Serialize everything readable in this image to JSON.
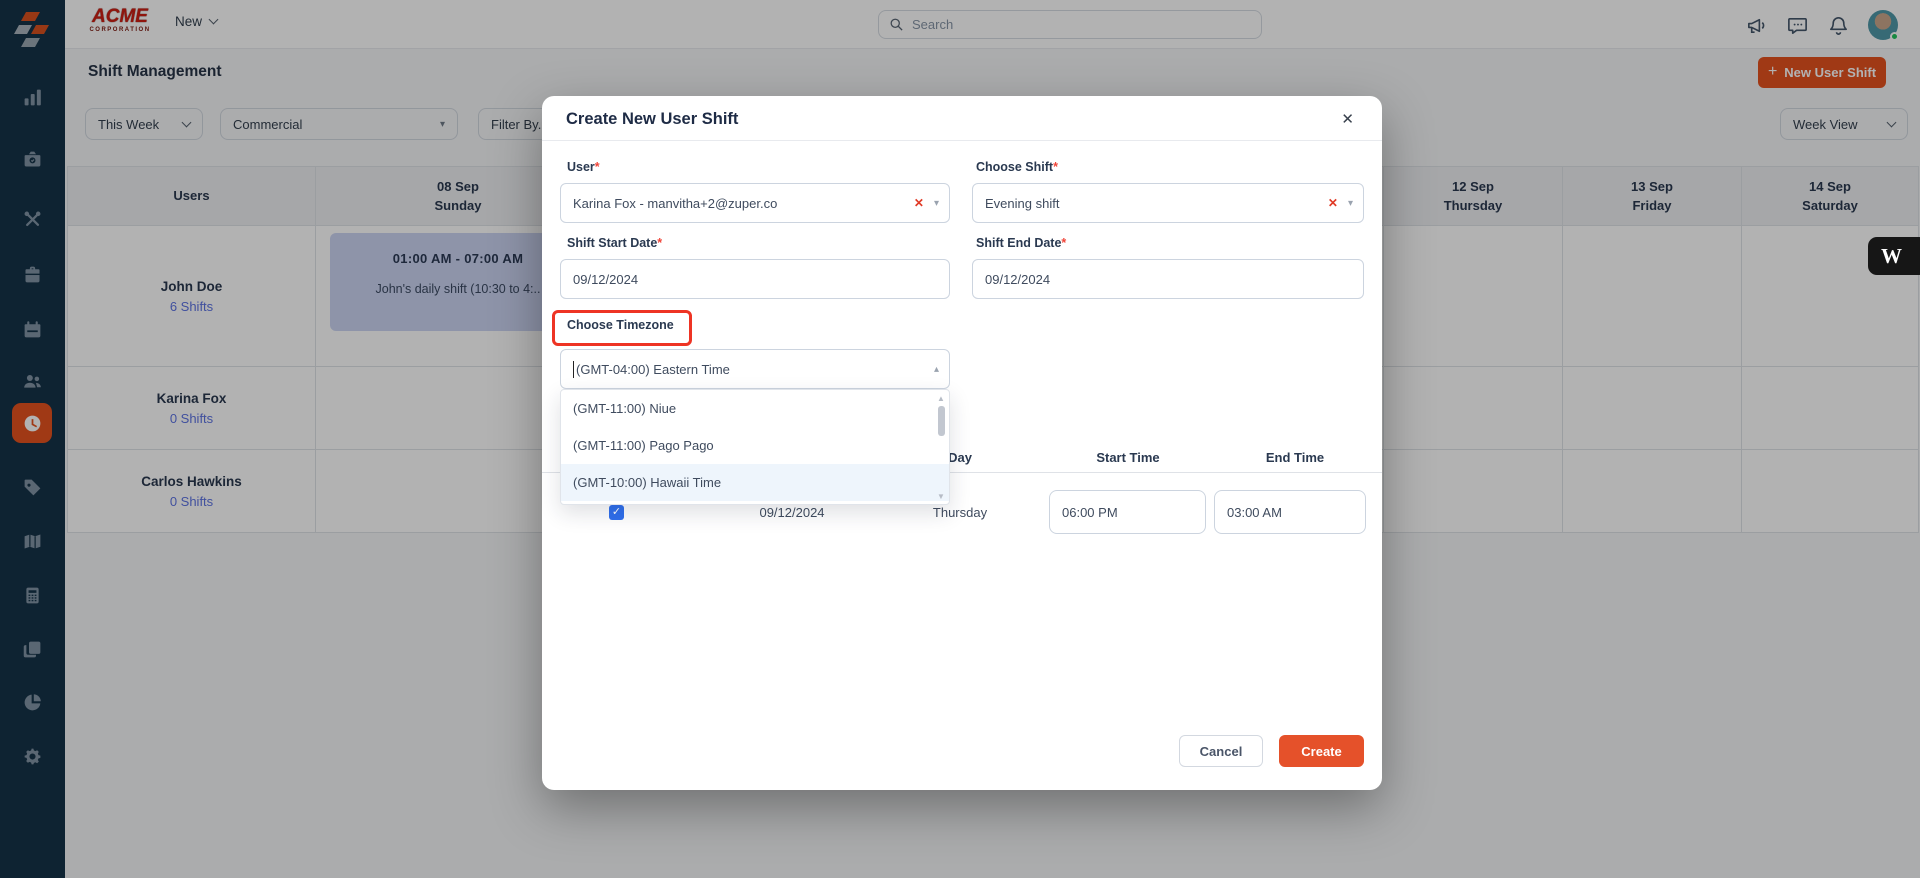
{
  "topbar": {
    "brand": "ACME",
    "brand_sub": "CORPORATION",
    "new_menu": "New",
    "search_placeholder": "Search"
  },
  "page": {
    "title": "Shift Management",
    "new_user_shift_button": "New User Shift"
  },
  "filters": {
    "range": "This Week",
    "category": "Commercial",
    "filter_by": "Filter By..",
    "view": "Week View"
  },
  "calendar": {
    "users_header": "Users",
    "days": [
      {
        "date": "08 Sep",
        "day": "Sunday"
      },
      {
        "date": "",
        "day": ""
      },
      {
        "date": "",
        "day": ""
      },
      {
        "date": "",
        "day": ""
      },
      {
        "date": "12 Sep",
        "day": "Thursday"
      },
      {
        "date": "13 Sep",
        "day": "Friday"
      },
      {
        "date": "14 Sep",
        "day": "Saturday"
      }
    ],
    "rows": [
      {
        "name": "John Doe",
        "shifts": "6 Shifts"
      },
      {
        "name": "Karina Fox",
        "shifts": "0 Shifts"
      },
      {
        "name": "Carlos Hawkins",
        "shifts": "0 Shifts"
      }
    ],
    "shift_card": {
      "time": "01:00 AM  -  07:00 AM",
      "title": "John's daily shift (10:30 to 4:.."
    }
  },
  "modal": {
    "title": "Create New User Shift",
    "required_mark": "*",
    "user_label": "User",
    "user_value": "Karina Fox - manvitha+2@zuper.co",
    "shift_label": "Choose Shift",
    "shift_value": "Evening shift",
    "start_date_label": "Shift Start Date",
    "start_date_value": "09/12/2024",
    "end_date_label": "Shift End Date",
    "end_date_value": "09/12/2024",
    "timezone_label": "Choose Timezone",
    "timezone_value": "(GMT-04:00) Eastern Time",
    "timezone_options": [
      {
        "label": "(GMT-11:00) Niue"
      },
      {
        "label": "(GMT-11:00) Pago Pago"
      },
      {
        "label": "(GMT-10:00) Hawaii Time",
        "highlighted": true
      }
    ],
    "schedule": {
      "day_header": "Day",
      "start_header": "Start Time",
      "end_header": "End Time",
      "row": {
        "date": "09/12/2024",
        "day": "Thursday",
        "start": "06:00 PM",
        "end": "03:00 AM",
        "checked": true
      }
    },
    "cancel": "Cancel",
    "create": "Create"
  },
  "widget": {
    "label": "W"
  },
  "icons": {
    "plus": "+",
    "caret_down": "▾",
    "caret_up": "▴",
    "close": "✕",
    "clear": "✕",
    "check": "✓",
    "scroll_up": "▲",
    "scroll_down": "▼"
  },
  "colors": {
    "accent": "#e6521f",
    "create_button": "#e5512a",
    "highlight_box": "#ee3424",
    "link": "#5d73e3",
    "sidebar": "#153348",
    "shift_card": "#ccd5f2"
  }
}
